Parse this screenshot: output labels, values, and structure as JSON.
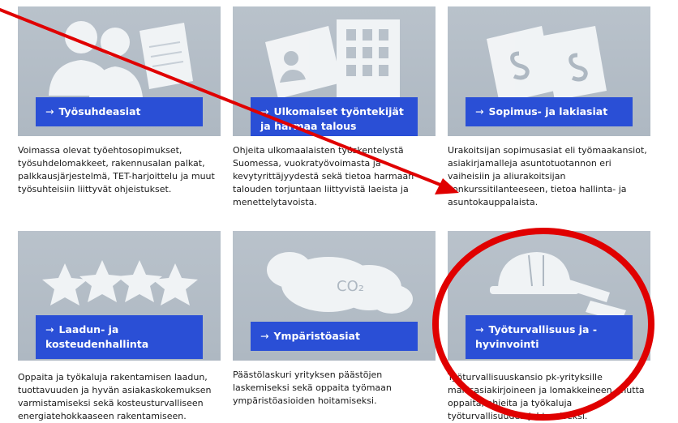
{
  "cards": [
    {
      "title": "Työsuhdeasiat",
      "arrow": "→",
      "icon": "people-document-icon",
      "description": "Voimassa olevat työehtosopimukset, työsuhdelomakkeet, rakennusalan palkat, palkkausjärjestelmä, TET-harjoittelu ja muut työsuhteisiin liittyvät ohjeistukset."
    },
    {
      "title": "Ulkomaiset työntekijät ja harmaa talous",
      "arrow": "→",
      "icon": "id-card-building-icon",
      "description": "Ohjeita ulkomaalaisten työskentelystä Suomessa, vuokratyövoimasta ja kevytyrittäjyydestä sekä tietoa harmaan talouden torjuntaan liittyvistä laeista ja menettelytavoista."
    },
    {
      "title": "Sopimus- ja lakiasiat",
      "arrow": "→",
      "icon": "legal-documents-icon",
      "description": "Urakoitsijan sopimusasiat eli työmaakansiot, asiakirjamalleja asuntotuotannon eri vaiheisiin ja aliurakoitsijan konkurssitilanteeseen, tietoa hallinta- ja asuntokauppalaista."
    },
    {
      "title": "Laadun- ja kosteudenhallinta",
      "arrow": "→",
      "icon": "stars-rating-icon",
      "description": "Oppaita ja työkaluja rakentamisen laadun, tuottavuuden ja hyvän asiakaskokemuksen varmistamiseksi sekä kosteusturvalliseen energiatehokkaaseen rakentamiseen."
    },
    {
      "title": "Ympäristöasiat",
      "arrow": "→",
      "icon": "co2-cloud-icon",
      "cloud_text": "CO₂",
      "description": "Päästölaskuri yrityksen päästöjen laskemiseksi sekä oppaita työmaan ympäristöasioiden hoitamiseksi."
    },
    {
      "title": "Työturvallisuus ja -hyvinvointi",
      "arrow": "→",
      "icon": "hard-hat-icon",
      "description": "Työturvallisuuskansio pk-yrityksille mallisasiakirjoineen ja lomakkeineen, mutta oppaita, ohjeita ja työkaluja työturvallisuuden johtamiseksi."
    }
  ],
  "annotations": {
    "arrow_color": "#e00000",
    "circle_color": "#e00000"
  }
}
